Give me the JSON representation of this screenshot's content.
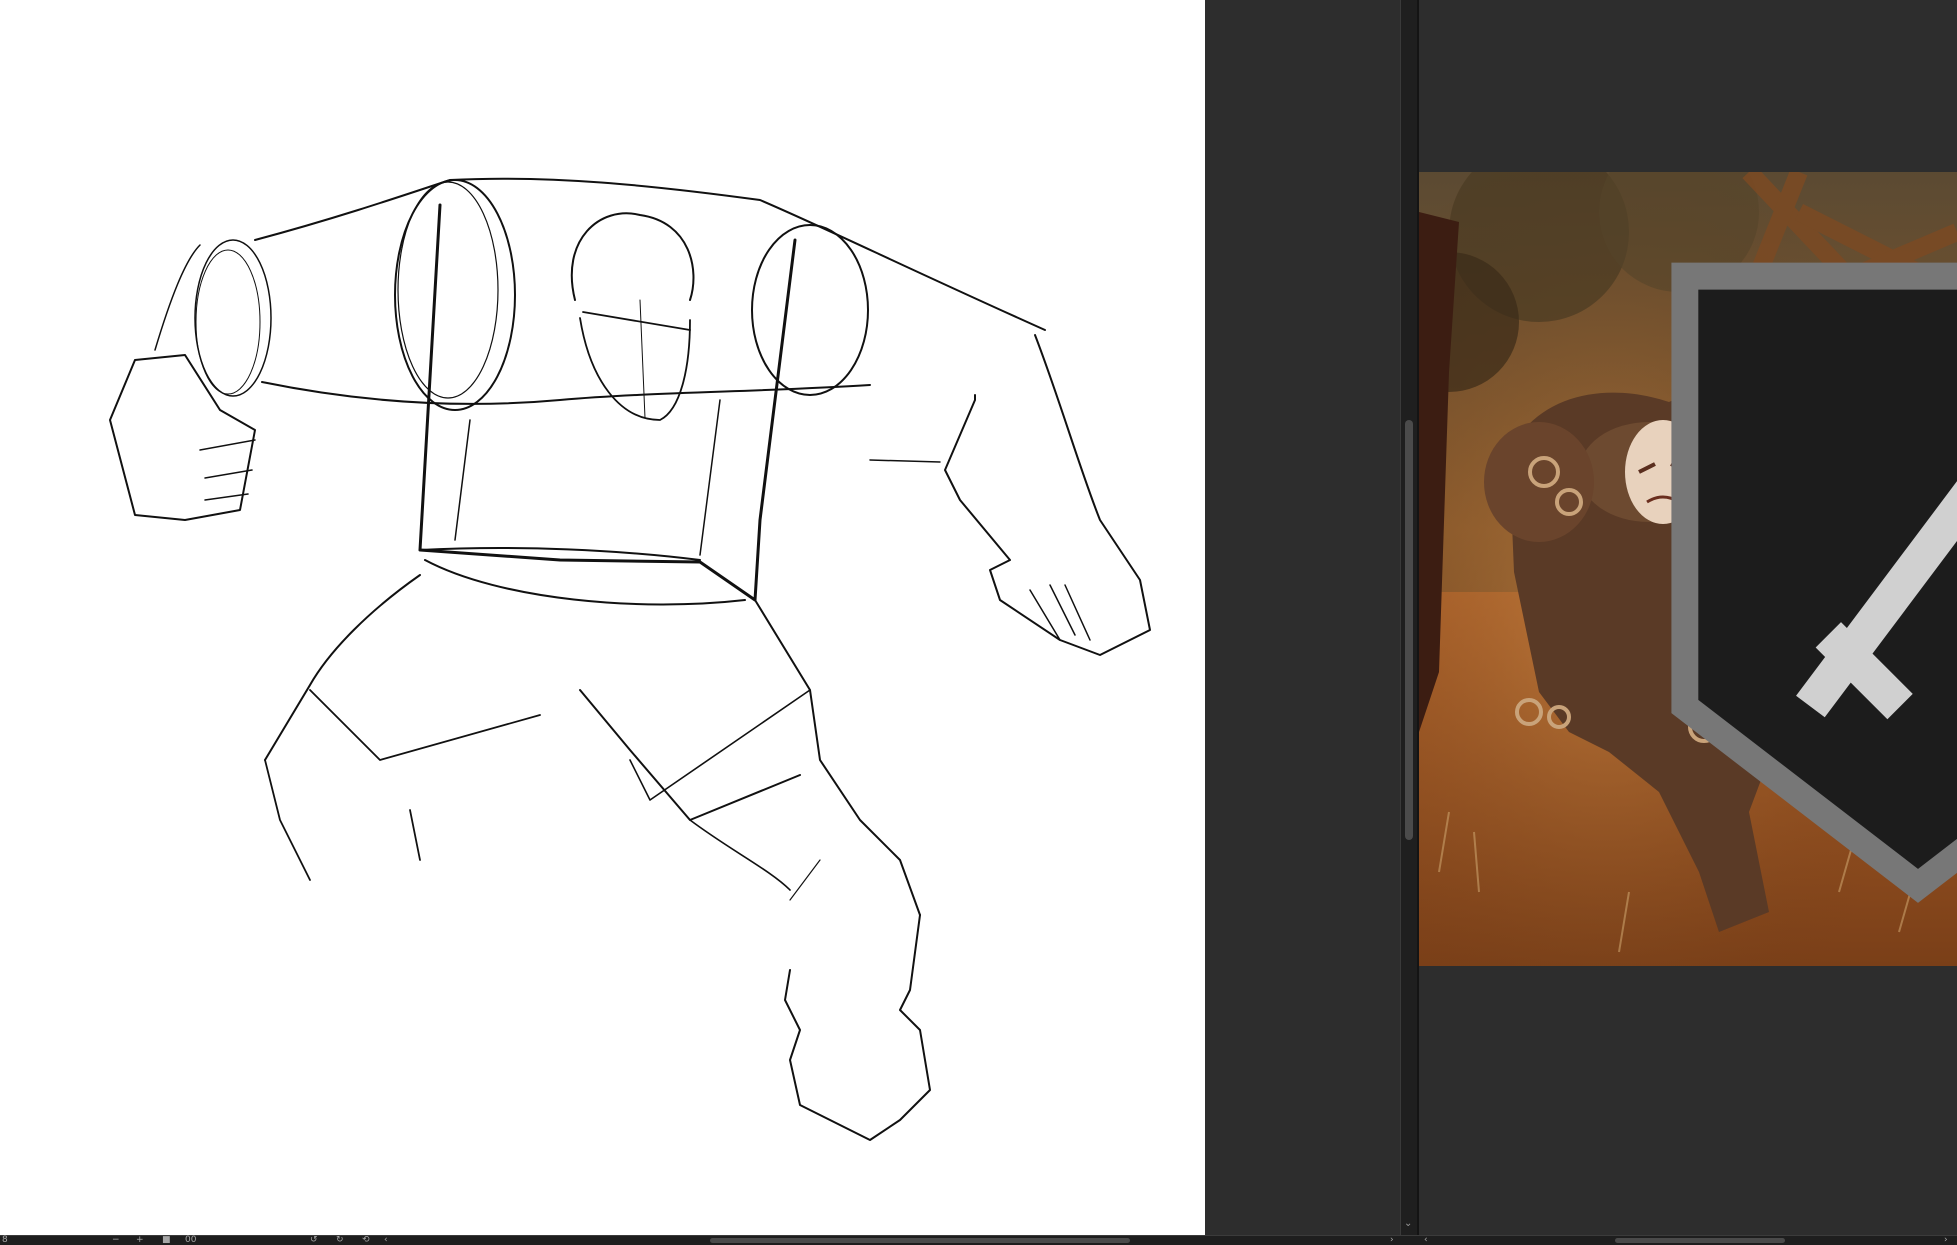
{
  "canvas": {
    "background": "#ffffff",
    "stroke_color": "#111111",
    "title": ""
  },
  "reference_panel": {
    "background": "#2d2d2d",
    "image_icon": "sword-emblem-icon",
    "image_subject": ""
  },
  "status_bar": {
    "zoom_out_icon": "−",
    "zoom_in_icon": "+",
    "zoom_value": "8",
    "fit_icon": "■",
    "actual_size_label": "00",
    "rotate_left_icon": "↺",
    "rotate_right_icon": "↻",
    "reset_rotation_icon": "⟲",
    "scroll_left_icon": "‹",
    "scroll_right_icon": "›",
    "ref_scroll_left_icon": "‹",
    "ref_scroll_right_icon": "›"
  },
  "vertical_scrollbar": {
    "down_arrow_icon": "⌄"
  }
}
